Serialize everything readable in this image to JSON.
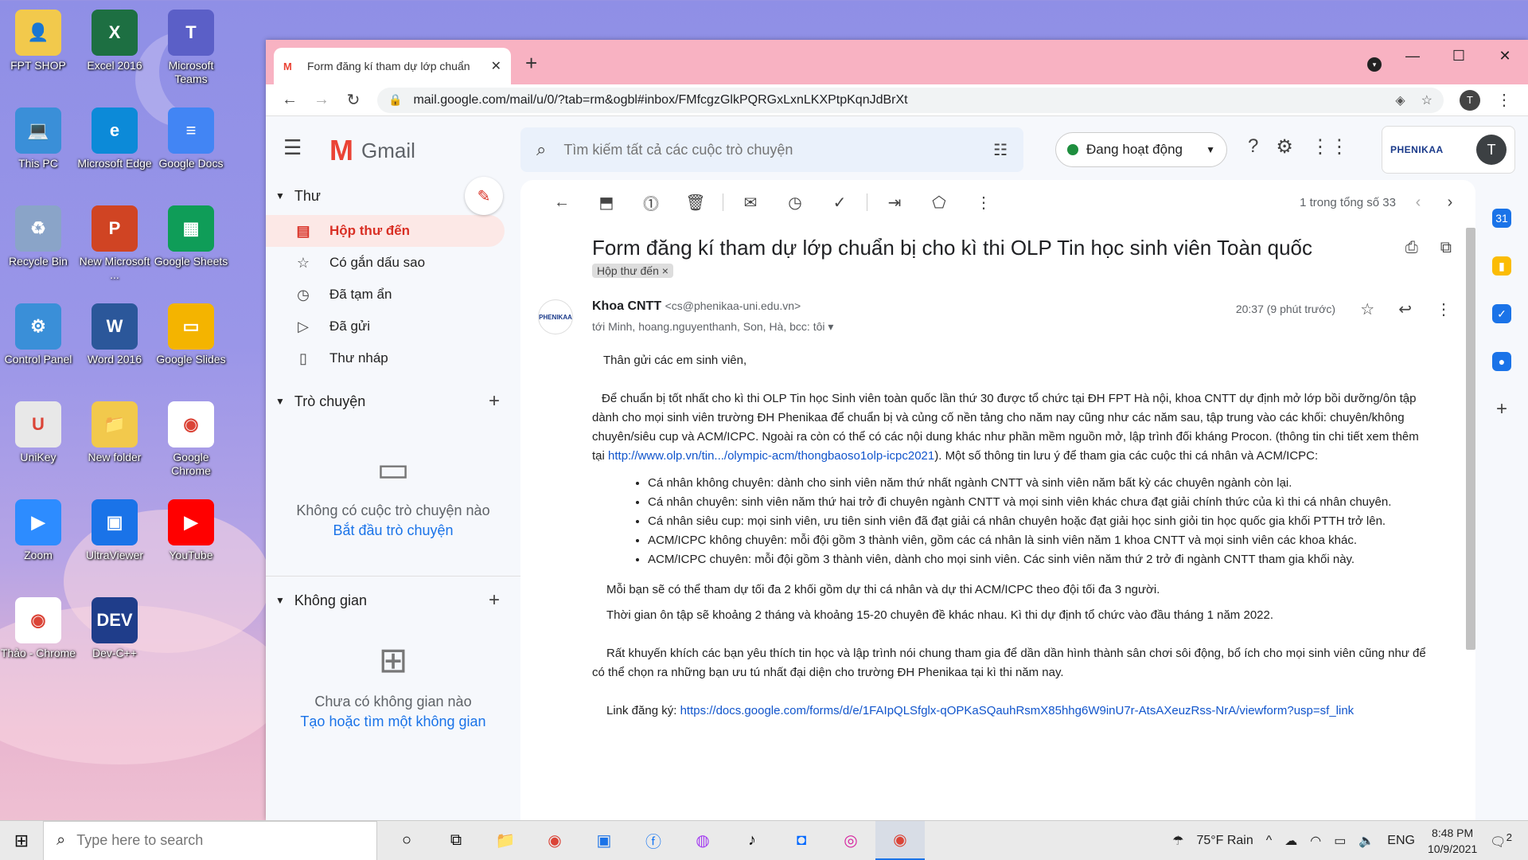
{
  "desktop": {
    "icons": [
      {
        "label": "FPT SHOP",
        "color": "#f2c94c",
        "glyph": "👤"
      },
      {
        "label": "Excel 2016",
        "color": "#1d6f42",
        "glyph": "X"
      },
      {
        "label": "Microsoft Teams",
        "color": "#5b5fc7",
        "glyph": "T"
      },
      {
        "label": "This PC",
        "color": "#3a8fd8",
        "glyph": "💻"
      },
      {
        "label": "Microsoft Edge",
        "color": "#0c8ad8",
        "glyph": "e"
      },
      {
        "label": "Google Docs",
        "color": "#4285f4",
        "glyph": "≡"
      },
      {
        "label": "Recycle Bin",
        "color": "#8aa4c8",
        "glyph": "♻"
      },
      {
        "label": "New Microsoft ...",
        "color": "#d04423",
        "glyph": "P"
      },
      {
        "label": "Google Sheets",
        "color": "#0f9d58",
        "glyph": "▦"
      },
      {
        "label": "Control Panel",
        "color": "#3a8fd8",
        "glyph": "⚙"
      },
      {
        "label": "Word 2016",
        "color": "#2b579a",
        "glyph": "W"
      },
      {
        "label": "Google Slides",
        "color": "#f4b400",
        "glyph": "▭"
      },
      {
        "label": "UniKey",
        "color": "#e8e8e8",
        "glyph": "U"
      },
      {
        "label": "New folder",
        "color": "#f2c94c",
        "glyph": "📁"
      },
      {
        "label": "Google Chrome",
        "color": "#ffffff",
        "glyph": "◉"
      },
      {
        "label": "Zoom",
        "color": "#2d8cff",
        "glyph": "▶"
      },
      {
        "label": "UltraViewer",
        "color": "#1a73e8",
        "glyph": "▣"
      },
      {
        "label": "YouTube",
        "color": "#ff0000",
        "glyph": "▶"
      },
      {
        "label": "Thảo - Chrome",
        "color": "#ffffff",
        "glyph": "◉"
      },
      {
        "label": "Dev-C++",
        "color": "#1f3d8a",
        "glyph": "DEV"
      }
    ]
  },
  "browser": {
    "tab_title": "Form đăng kí tham dự lớp chuẩn",
    "tab_close": "✕",
    "new_tab": "+",
    "url": "mail.google.com/mail/u/0/?tab=rm&ogbl#inbox/FMfcgzGlkPQRGxLxnLKXPtpKqnJdBrXt",
    "profile_initial": "T"
  },
  "gmail": {
    "brand": "Gmail",
    "search_placeholder": "Tìm kiếm tất cả các cuộc trò chuyện",
    "status": "Đang hoạt động",
    "org_name": "PHENIKAA",
    "avatar_initial": "T",
    "sections": {
      "mail": "Thư",
      "chat": "Trò chuyện",
      "spaces": "Không gian"
    },
    "nav": [
      {
        "label": "Hộp thư đến",
        "icon": "inbox-icon",
        "glyph": "▤",
        "active": true
      },
      {
        "label": "Có gắn dấu sao",
        "icon": "star-icon",
        "glyph": "☆",
        "active": false
      },
      {
        "label": "Đã tạm ẩn",
        "icon": "clock-icon",
        "glyph": "◷",
        "active": false
      },
      {
        "label": "Đã gửi",
        "icon": "send-icon",
        "glyph": "▷",
        "active": false
      },
      {
        "label": "Thư nháp",
        "icon": "draft-icon",
        "glyph": "▯",
        "active": false
      }
    ],
    "chat_empty": "Không có cuộc trò chuyện nào",
    "chat_start": "Bắt đầu trò chuyện",
    "spaces_empty": "Chưa có không gian nào",
    "spaces_create": "Tạo hoặc tìm một không gian",
    "pagination": "1 trong tổng số 33",
    "email": {
      "subject": "Form đăng kí tham dự lớp chuẩn bị cho kì thi OLP Tin học sinh viên Toàn quốc",
      "label": "Hộp thư đến ×",
      "sender_name": "Khoa CNTT",
      "sender_email": "<cs@phenikaa-uni.edu.vn>",
      "recipients": "tới Minh, hoang.nguyenthanh, Son, Hà, bcc: tôi",
      "time": "20:37 (9 phút trước)",
      "sender_logo": "PHENIKAA",
      "greeting": "Thân gửi các em sinh viên,",
      "para1_a": "Để chuẩn bị tốt nhất cho kì thi OLP Tin học Sinh viên toàn quốc lần thứ 30 được tổ chức tại ĐH FPT Hà nội, khoa CNTT dự định mở lớp bồi dưỡng/ôn tập dành cho mọi sinh viên trường ĐH Phenikaa để chuẩn bị và củng cố nền tảng cho năm nay cũng như các năm sau, tập trung vào các khối: chuyên/không chuyên/siêu cup và ACM/ICPC. Ngoài ra còn có thể có các nội dung khác như phần mềm nguồn mở, lập trình đối kháng Procon. (thông tin chi tiết xem thêm tại ",
      "para1_link": "http://www.olp.vn/tin.../olympic-acm/thongbaoso1olp-icpc2021",
      "para1_b": "). Một số thông tin lưu ý để tham gia các cuộc thi cá nhân và ACM/ICPC:",
      "bullets": [
        "Cá nhân không chuyên: dành cho sinh viên năm thứ nhất ngành CNTT và sinh viên năm bất kỳ các chuyên ngành còn lại.",
        "Cá nhân chuyên: sinh viên năm thứ hai trở đi chuyên ngành CNTT và mọi sinh viên khác chưa đạt giải chính thức của kì thi cá nhân chuyên.",
        "Cá nhân siêu cup: mọi sinh viên, ưu tiên sinh viên đã đạt giải cá nhân chuyên hoặc đạt giải học sinh giỏi tin học quốc gia khối PTTH trở lên.",
        "ACM/ICPC không chuyên: mỗi đội gồm 3 thành viên, gồm các cá nhân là sinh viên năm 1 khoa CNTT và mọi sinh viên các khoa khác.",
        "ACM/ICPC chuyên: mỗi đội gồm 3 thành viên, dành cho mọi sinh viên. Các sinh viên năm thứ 2 trở đi ngành CNTT tham gia khối này."
      ],
      "para2": "Mỗi bạn sẽ có thể tham dự tối đa 2 khối gồm dự thi cá nhân và dự thi ACM/ICPC theo đội tối đa 3 người.",
      "para3": "Thời gian ôn tập sẽ khoảng 2 tháng và khoảng 15-20 chuyên đề khác nhau. Kì thi dự định tổ chức vào đầu tháng 1 năm 2022.",
      "para4": "Rất khuyến khích các bạn yêu thích tin học và lập trình nói chung tham gia để dần dần hình thành sân chơi sôi động, bổ ích cho mọi sinh viên cũng như để có thể chọn ra những bạn ưu tú nhất đại diện cho trường ĐH Phenikaa tại kì thi năm nay.",
      "link_label": "Link đăng ký: ",
      "link_url": "https://docs.google.com/forms/d/e/1FAIpQLSfglx-qOPKaSQauhRsmX85hhg6W9inU7r-AtsAXeuzRss-NrA/viewform?usp=sf_link"
    }
  },
  "taskbar": {
    "search_placeholder": "Type here to search",
    "weather": "75°F  Rain",
    "lang": "ENG",
    "time": "8:48 PM",
    "date": "10/9/2021",
    "notif": "2"
  }
}
